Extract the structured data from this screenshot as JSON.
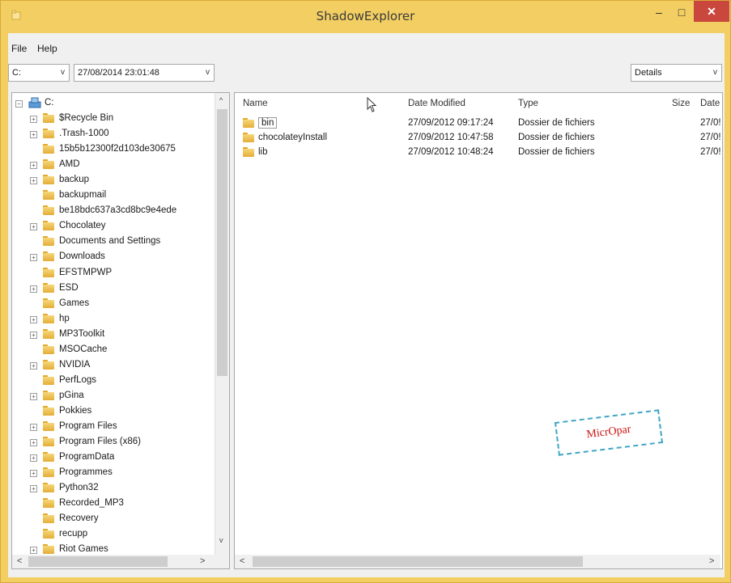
{
  "window": {
    "title": "ShadowExplorer",
    "minimize_glyph": "–",
    "maximize_glyph": "□",
    "close_glyph": "✕"
  },
  "menu": {
    "file": "File",
    "help": "Help"
  },
  "toolbar": {
    "drive": "C:",
    "snapshot": "27/08/2014 23:01:48",
    "view": "Details",
    "arrow_glyph": "v"
  },
  "tree": {
    "root": "C:",
    "items": [
      {
        "label": "$Recycle Bin",
        "expandable": true
      },
      {
        "label": ".Trash-1000",
        "expandable": true
      },
      {
        "label": "15b5b12300f2d103de30675",
        "expandable": false
      },
      {
        "label": "AMD",
        "expandable": true
      },
      {
        "label": "backup",
        "expandable": true
      },
      {
        "label": "backupmail",
        "expandable": false
      },
      {
        "label": "be18bdc637a3cd8bc9e4ede",
        "expandable": false
      },
      {
        "label": "Chocolatey",
        "expandable": true
      },
      {
        "label": "Documents and Settings",
        "expandable": false
      },
      {
        "label": "Downloads",
        "expandable": true
      },
      {
        "label": "EFSTMPWP",
        "expandable": false
      },
      {
        "label": "ESD",
        "expandable": true
      },
      {
        "label": "Games",
        "expandable": false
      },
      {
        "label": "hp",
        "expandable": true
      },
      {
        "label": "MP3Toolkit",
        "expandable": true
      },
      {
        "label": "MSOCache",
        "expandable": false
      },
      {
        "label": "NVIDIA",
        "expandable": true
      },
      {
        "label": "PerfLogs",
        "expandable": false
      },
      {
        "label": "pGina",
        "expandable": true
      },
      {
        "label": "Pokkies",
        "expandable": false
      },
      {
        "label": "Program Files",
        "expandable": true
      },
      {
        "label": "Program Files (x86)",
        "expandable": true
      },
      {
        "label": "ProgramData",
        "expandable": true
      },
      {
        "label": "Programmes",
        "expandable": true
      },
      {
        "label": "Python32",
        "expandable": true
      },
      {
        "label": "Recorded_MP3",
        "expandable": false
      },
      {
        "label": "Recovery",
        "expandable": false
      },
      {
        "label": "recupp",
        "expandable": false
      },
      {
        "label": "Riot Games",
        "expandable": true
      }
    ]
  },
  "list": {
    "columns": {
      "name": "Name",
      "date_modified": "Date Modified",
      "type": "Type",
      "size": "Size",
      "date": "Date"
    },
    "rows": [
      {
        "name": "bin",
        "date_modified": "27/09/2012 09:17:24",
        "type": "Dossier de fichiers",
        "date": "27/0!"
      },
      {
        "name": "chocolateyInstall",
        "date_modified": "27/09/2012 10:47:58",
        "type": "Dossier de fichiers",
        "date": "27/0!"
      },
      {
        "name": "lib",
        "date_modified": "27/09/2012 10:48:24",
        "type": "Dossier de fichiers",
        "date": "27/0!"
      }
    ]
  },
  "scroll": {
    "up": "^",
    "down": "v",
    "left": "<",
    "right": ">"
  },
  "watermark": "MicrOpar",
  "colors": {
    "title_bar": "#f3cf63",
    "close_button": "#c9473c",
    "watermark_text": "#cc1111",
    "watermark_border": "#3fa6c5"
  }
}
